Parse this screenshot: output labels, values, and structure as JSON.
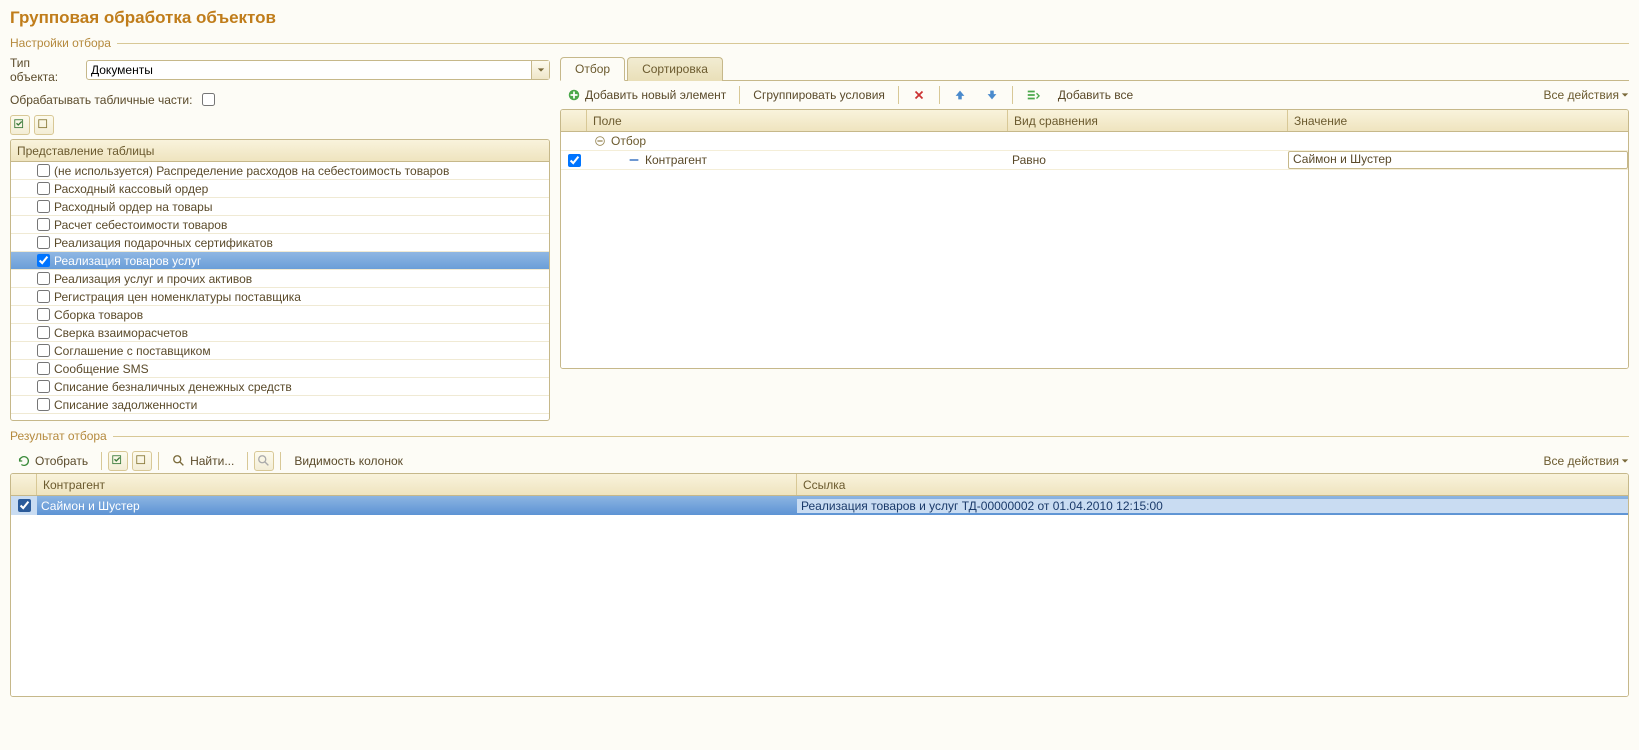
{
  "page_title": "Групповая обработка объектов",
  "settings": {
    "legend": "Настройки отбора",
    "type_label": "Тип объекта:",
    "type_value": "Документы",
    "process_tables_label": "Обрабатывать табличные части:",
    "process_tables_checked": false,
    "tree_header": "Представление таблицы",
    "tree_items": [
      {
        "label": "(не используется) Распределение расходов на себестоимость товаров",
        "checked": false,
        "selected": false
      },
      {
        "label": "Расходный кассовый ордер",
        "checked": false,
        "selected": false
      },
      {
        "label": "Расходный ордер на товары",
        "checked": false,
        "selected": false
      },
      {
        "label": "Расчет себестоимости товаров",
        "checked": false,
        "selected": false
      },
      {
        "label": "Реализация подарочных сертификатов",
        "checked": false,
        "selected": false
      },
      {
        "label": "Реализация товаров услуг",
        "checked": true,
        "selected": true
      },
      {
        "label": "Реализация услуг и прочих активов",
        "checked": false,
        "selected": false
      },
      {
        "label": "Регистрация цен номенклатуры поставщика",
        "checked": false,
        "selected": false
      },
      {
        "label": "Сборка товаров",
        "checked": false,
        "selected": false
      },
      {
        "label": "Сверка взаиморасчетов",
        "checked": false,
        "selected": false
      },
      {
        "label": "Соглашение с поставщиком",
        "checked": false,
        "selected": false
      },
      {
        "label": "Сообщение SMS",
        "checked": false,
        "selected": false
      },
      {
        "label": "Списание безналичных денежных средств",
        "checked": false,
        "selected": false
      },
      {
        "label": "Списание задолженности",
        "checked": false,
        "selected": false
      }
    ]
  },
  "filter": {
    "tabs": [
      {
        "label": "Отбор",
        "active": true
      },
      {
        "label": "Сортировка",
        "active": false
      }
    ],
    "toolbar": {
      "add_element": "Добавить новый элемент",
      "group_conditions": "Сгруппировать условия",
      "add_all": "Добавить все",
      "all_actions": "Все действия"
    },
    "headers": {
      "field": "Поле",
      "comparison": "Вид сравнения",
      "value": "Значение"
    },
    "group_label": "Отбор",
    "row": {
      "checked": true,
      "field": "Контрагент",
      "comparison": "Равно",
      "value": "Саймон и Шустер"
    }
  },
  "result": {
    "legend": "Результат отбора",
    "toolbar": {
      "select": "Отобрать",
      "find": "Найти...",
      "columns": "Видимость колонок",
      "all_actions": "Все действия"
    },
    "headers": {
      "counterparty": "Контрагент",
      "link": "Ссылка"
    },
    "row": {
      "checked": true,
      "counterparty": "Саймон и Шустер",
      "link": "Реализация товаров и услуг ТД-00000002 от 01.04.2010 12:15:00"
    }
  }
}
